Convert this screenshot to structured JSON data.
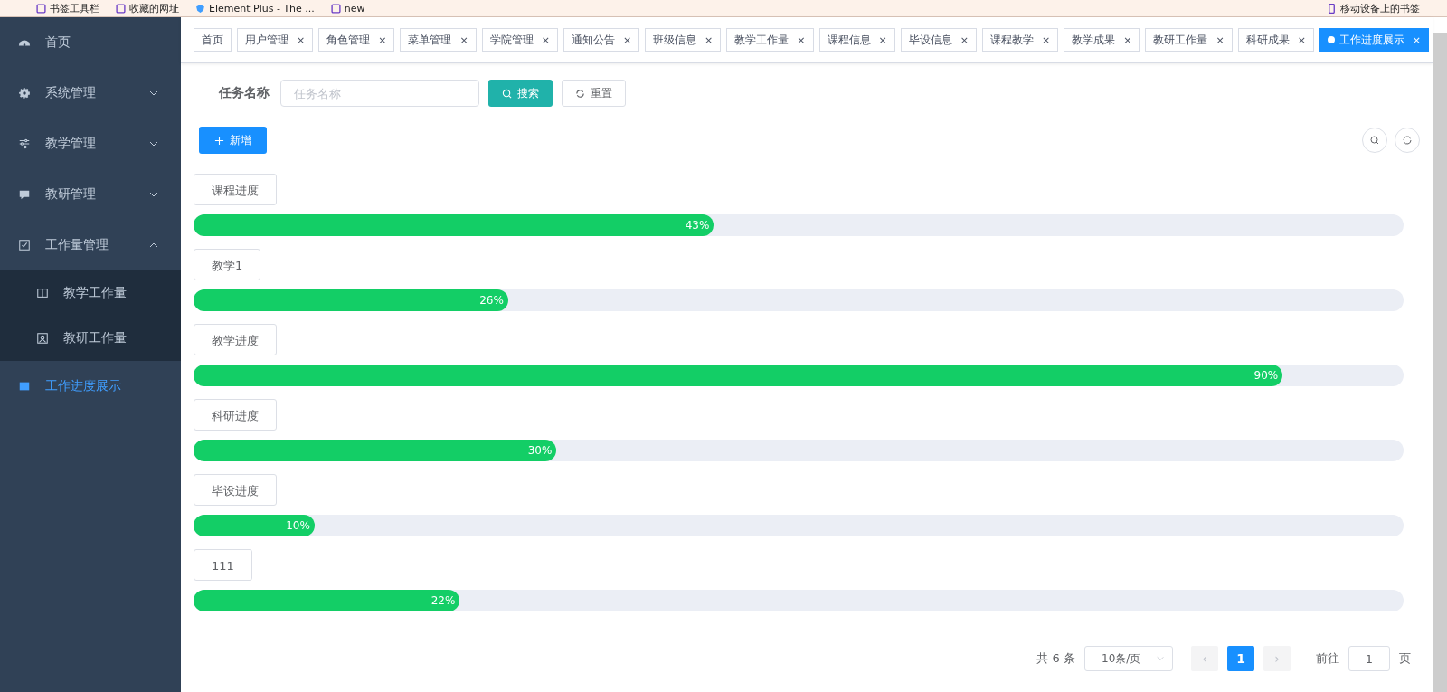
{
  "bookmarks": [
    {
      "label": "书签工具栏",
      "kind": "folder"
    },
    {
      "label": "收藏的网址",
      "kind": "folder"
    },
    {
      "label": "Element Plus - The ...",
      "kind": "site"
    },
    {
      "label": "new",
      "kind": "folder"
    },
    {
      "label": "移动设备上的书签",
      "kind": "mobile"
    }
  ],
  "sidebar": {
    "items": [
      {
        "label": "首页",
        "selected": false
      },
      {
        "label": "系统管理",
        "expanded": false,
        "selected": false
      },
      {
        "label": "教学管理",
        "expanded": false,
        "selected": false
      },
      {
        "label": "教研管理",
        "expanded": false,
        "selected": false
      },
      {
        "label": "工作量管理",
        "expanded": true,
        "selected": false,
        "children": [
          {
            "label": "教学工作量",
            "selected": false
          },
          {
            "label": "教研工作量",
            "selected": false
          }
        ]
      },
      {
        "label": "工作进度展示",
        "selected": true
      }
    ]
  },
  "tabs": [
    {
      "label": "首页",
      "closable": false,
      "selected": false
    },
    {
      "label": "用户管理",
      "closable": true,
      "selected": false
    },
    {
      "label": "角色管理",
      "closable": true,
      "selected": false
    },
    {
      "label": "菜单管理",
      "closable": true,
      "selected": false
    },
    {
      "label": "学院管理",
      "closable": true,
      "selected": false
    },
    {
      "label": "通知公告",
      "closable": true,
      "selected": false
    },
    {
      "label": "班级信息",
      "closable": true,
      "selected": false
    },
    {
      "label": "教学工作量",
      "closable": true,
      "selected": false
    },
    {
      "label": "课程信息",
      "closable": true,
      "selected": false
    },
    {
      "label": "毕设信息",
      "closable": true,
      "selected": false
    },
    {
      "label": "课程教学",
      "closable": true,
      "selected": false
    },
    {
      "label": "教学成果",
      "closable": true,
      "selected": false
    },
    {
      "label": "教研工作量",
      "closable": true,
      "selected": false
    },
    {
      "label": "科研成果",
      "closable": true,
      "selected": false
    },
    {
      "label": "工作进度展示",
      "closable": true,
      "selected": true
    }
  ],
  "close_mark": "×",
  "search": {
    "label": "任务名称",
    "placeholder": "任务名称",
    "search_button": "搜索",
    "reset_button": "重置"
  },
  "add_button": "新增",
  "progress": [
    {
      "label": "课程进度",
      "level": 0.43,
      "reading": "43%"
    },
    {
      "label": "教学1",
      "level": 0.26,
      "reading": "26%"
    },
    {
      "label": "教学进度",
      "level": 0.9,
      "reading": "90%"
    },
    {
      "label": "科研进度",
      "level": 0.3,
      "reading": "30%"
    },
    {
      "label": "毕设进度",
      "level": 0.1,
      "reading": "10%"
    },
    {
      "label": "111",
      "level": 0.22,
      "reading": "22%"
    }
  ],
  "pagination": {
    "total": "共 6 条",
    "page_size": "10条/页",
    "pages": [
      {
        "label": "1",
        "selected": true
      }
    ],
    "prev": "‹",
    "next": "›",
    "goto_label": "前往",
    "goto_value": "1",
    "goto_suffix": "页"
  }
}
